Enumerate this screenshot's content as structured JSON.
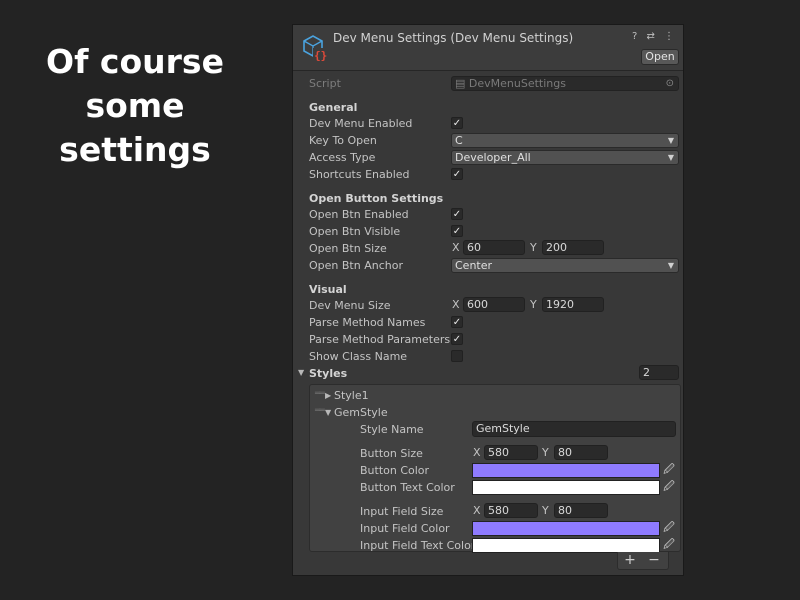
{
  "caption": {
    "line1": "Of course some",
    "line2": "settings"
  },
  "inspector": {
    "title": "Dev Menu Settings (Dev Menu Settings)",
    "tools": "? ⇄ ⋮",
    "open_label": "Open",
    "script_label": "Script",
    "script_value": "DevMenuSettings",
    "general": {
      "header": "General",
      "dev_menu_enabled": "Dev Menu Enabled",
      "key_to_open": "Key To Open",
      "key_to_open_value": "C",
      "access_type": "Access Type",
      "access_type_value": "Developer_All",
      "shortcuts_enabled": "Shortcuts Enabled"
    },
    "open_button": {
      "header": "Open Button Settings",
      "enabled": "Open Btn Enabled",
      "visible": "Open Btn Visible",
      "size": "Open Btn Size",
      "size_x": "60",
      "size_y": "200",
      "anchor": "Open Btn Anchor",
      "anchor_value": "Center"
    },
    "visual": {
      "header": "Visual",
      "menu_size": "Dev Menu Size",
      "menu_size_x": "600",
      "menu_size_y": "1920",
      "parse_method_names": "Parse Method Names",
      "parse_method_params": "Parse Method Parameters",
      "show_class_name": "Show Class Name"
    },
    "styles": {
      "header": "Styles",
      "count": "2",
      "items": [
        {
          "name": "Style1"
        },
        {
          "name": "GemStyle"
        }
      ],
      "gem": {
        "style_name_label": "Style Name",
        "style_name_value": "GemStyle",
        "button_size": "Button Size",
        "button_size_x": "580",
        "button_size_y": "80",
        "button_color": "Button Color",
        "button_text_color": "Button Text Color",
        "input_field_size": "Input Field Size",
        "input_size_x": "580",
        "input_size_y": "80",
        "input_field_color": "Input Field Color",
        "input_field_text_color": "Input Field Text Color"
      }
    },
    "x_label": "X",
    "y_label": "Y",
    "plus": "+",
    "minus": "−"
  },
  "colors": {
    "purple": "#8f7bff",
    "white": "#ffffff",
    "icon_blue": "#4aa3df",
    "icon_red": "#e04a3a"
  }
}
